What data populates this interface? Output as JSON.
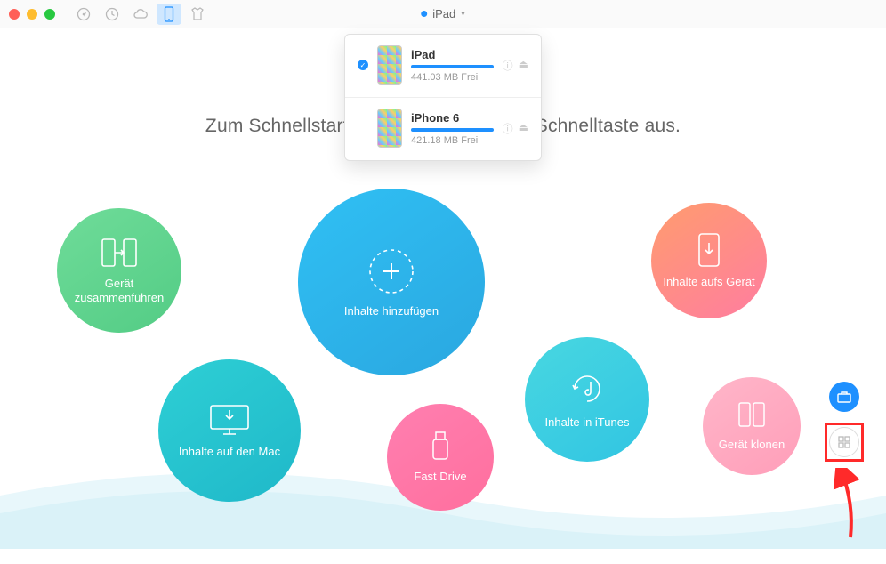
{
  "header": {
    "selected_device": "iPad"
  },
  "dropdown": {
    "devices": [
      {
        "name": "iPad",
        "free": "441.03 MB Frei",
        "selected": true
      },
      {
        "name": "iPhone 6",
        "free": "421.18 MB Frei",
        "selected": false
      }
    ]
  },
  "heading": "Zum Schnellstart wählen Sie bitte eine Schnelltaste aus.",
  "bubbles": {
    "merge": "Gerät zusammenführen",
    "add": "Inhalte hinzufügen",
    "to_device": "Inhalte aufs Gerät",
    "to_mac": "Inhalte auf den Mac",
    "fast_drive": "Fast Drive",
    "to_itunes": "Inhalte in iTunes",
    "clone": "Gerät klonen"
  }
}
